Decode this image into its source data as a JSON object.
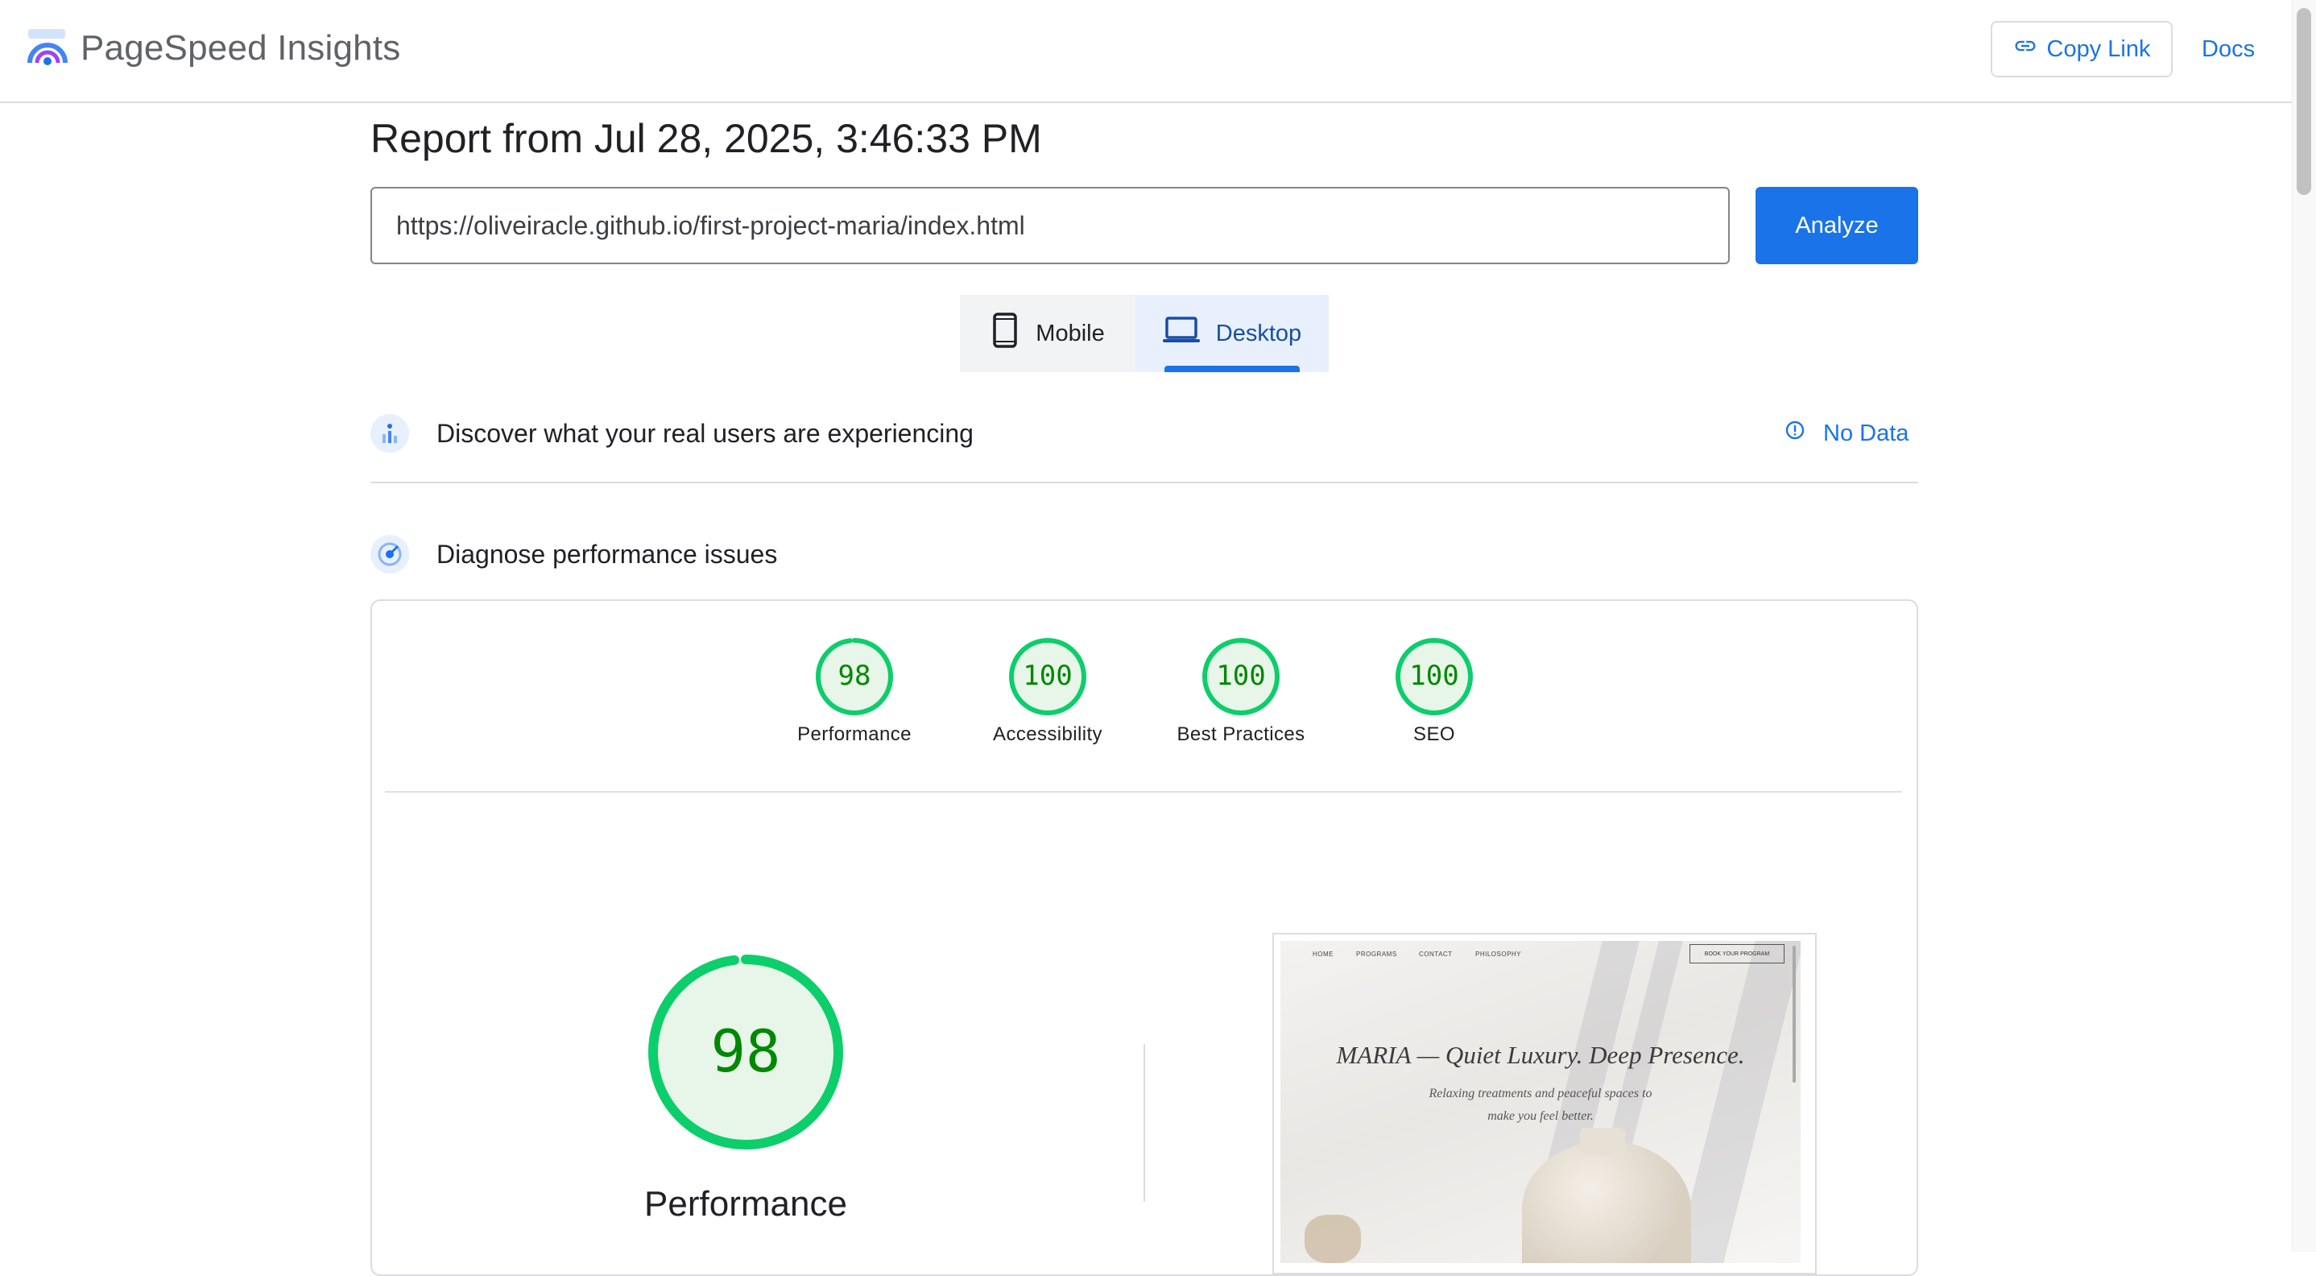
{
  "header": {
    "brand": "PageSpeed Insights",
    "copy_link_label": "Copy Link",
    "docs_label": "Docs"
  },
  "report": {
    "title": "Report from Jul 28, 2025, 3:46:33 PM",
    "url_value": "https://oliveiracle.github.io/first-project-maria/index.html",
    "analyze_label": "Analyze"
  },
  "device_tabs": [
    {
      "label": "Mobile",
      "icon": "phone-icon",
      "selected": false
    },
    {
      "label": "Desktop",
      "icon": "laptop-icon",
      "selected": true
    }
  ],
  "sections": {
    "real_users": {
      "title": "Discover what your real users are experiencing",
      "status": "No Data"
    },
    "diagnose": {
      "title": "Diagnose performance issues"
    }
  },
  "scores": [
    {
      "label": "Performance",
      "value": "98"
    },
    {
      "label": "Accessibility",
      "value": "100"
    },
    {
      "label": "Best Practices",
      "value": "100"
    },
    {
      "label": "SEO",
      "value": "100"
    }
  ],
  "performance": {
    "score": "98",
    "label": "Performance"
  },
  "screenshot": {
    "nav": [
      "HOME",
      "PROGRAMS",
      "CONTACT",
      "PHILOSOPHY"
    ],
    "cta": "BOOK YOUR PROGRAM",
    "heading": "MARIA — Quiet Luxury. Deep Presence.",
    "subtitle": "Relaxing treatments and peaceful spaces to make you feel better."
  },
  "colors": {
    "accent": "#1a73e8",
    "score_green": "#0cce6b",
    "score_text": "#008800",
    "score_fill": "#e8f5e9"
  }
}
